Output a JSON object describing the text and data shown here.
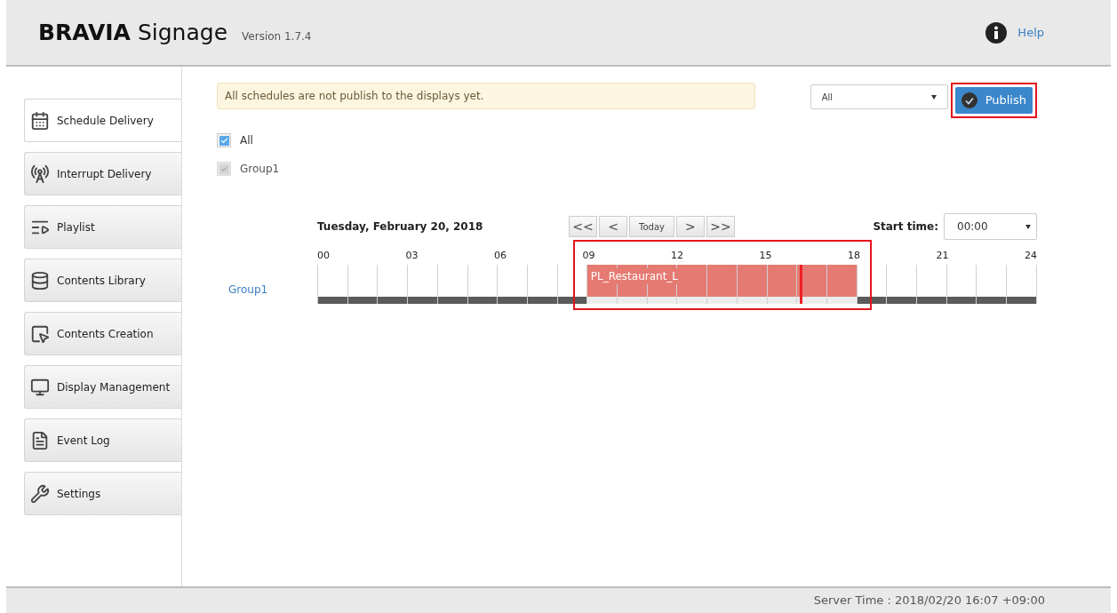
{
  "header": {
    "brand_bold": "BRAVIA",
    "brand_rest": "Signage",
    "version": "Version 1.7.4",
    "help": "Help"
  },
  "sidebar": {
    "items": [
      {
        "label": "Schedule Delivery",
        "kind": "calendar",
        "selected": true
      },
      {
        "label": "Interrupt Delivery",
        "kind": "broadcast",
        "selected": false
      },
      {
        "label": "Playlist",
        "kind": "playlist",
        "selected": false
      },
      {
        "label": "Contents Library",
        "kind": "library",
        "selected": false
      },
      {
        "label": "Contents Creation",
        "kind": "creation",
        "selected": false
      },
      {
        "label": "Display Management",
        "kind": "monitor",
        "selected": false
      },
      {
        "label": "Event Log",
        "kind": "log",
        "selected": false
      },
      {
        "label": "Settings",
        "kind": "settings",
        "selected": false
      }
    ]
  },
  "notice": "All schedules are not publish to the displays yet.",
  "filter": {
    "value": "All"
  },
  "publish": {
    "label": "Publish",
    "highlighted": true
  },
  "groups": [
    {
      "label": "All",
      "checked": true,
      "disabled": false
    },
    {
      "label": "Group1",
      "checked": true,
      "disabled": true
    }
  ],
  "timeline": {
    "date": "Tuesday, February 20, 2018",
    "nav": [
      {
        "label": "<<"
      },
      {
        "label": "<"
      },
      {
        "label": "Today"
      },
      {
        "label": ">"
      },
      {
        "label": ">>"
      }
    ],
    "start_time_label": "Start time:",
    "start_time": "00:00",
    "hours": [
      "00",
      "03",
      "06",
      "09",
      "12",
      "15",
      "18",
      "21",
      "24"
    ],
    "rows": [
      {
        "group": "Group1",
        "schedule_label": "PL_Restaurant_L",
        "highlighted": true,
        "now": {
          "level": 0.672
        },
        "slots": [
          {
            "scheduled": false
          },
          {
            "scheduled": false
          },
          {
            "scheduled": false
          },
          {
            "scheduled": false
          },
          {
            "scheduled": false
          },
          {
            "scheduled": false
          },
          {
            "scheduled": false
          },
          {
            "scheduled": false
          },
          {
            "scheduled": false
          },
          {
            "scheduled": true
          },
          {
            "scheduled": true
          },
          {
            "scheduled": true
          },
          {
            "scheduled": true
          },
          {
            "scheduled": true
          },
          {
            "scheduled": true
          },
          {
            "scheduled": true
          },
          {
            "scheduled": true
          },
          {
            "scheduled": true
          },
          {
            "scheduled": false
          },
          {
            "scheduled": false
          },
          {
            "scheduled": false
          },
          {
            "scheduled": false
          },
          {
            "scheduled": false
          },
          {
            "scheduled": false
          }
        ]
      }
    ]
  },
  "status_bar": {
    "server_time": "Server Time : 2018/02/20 16:07 +09:00"
  }
}
